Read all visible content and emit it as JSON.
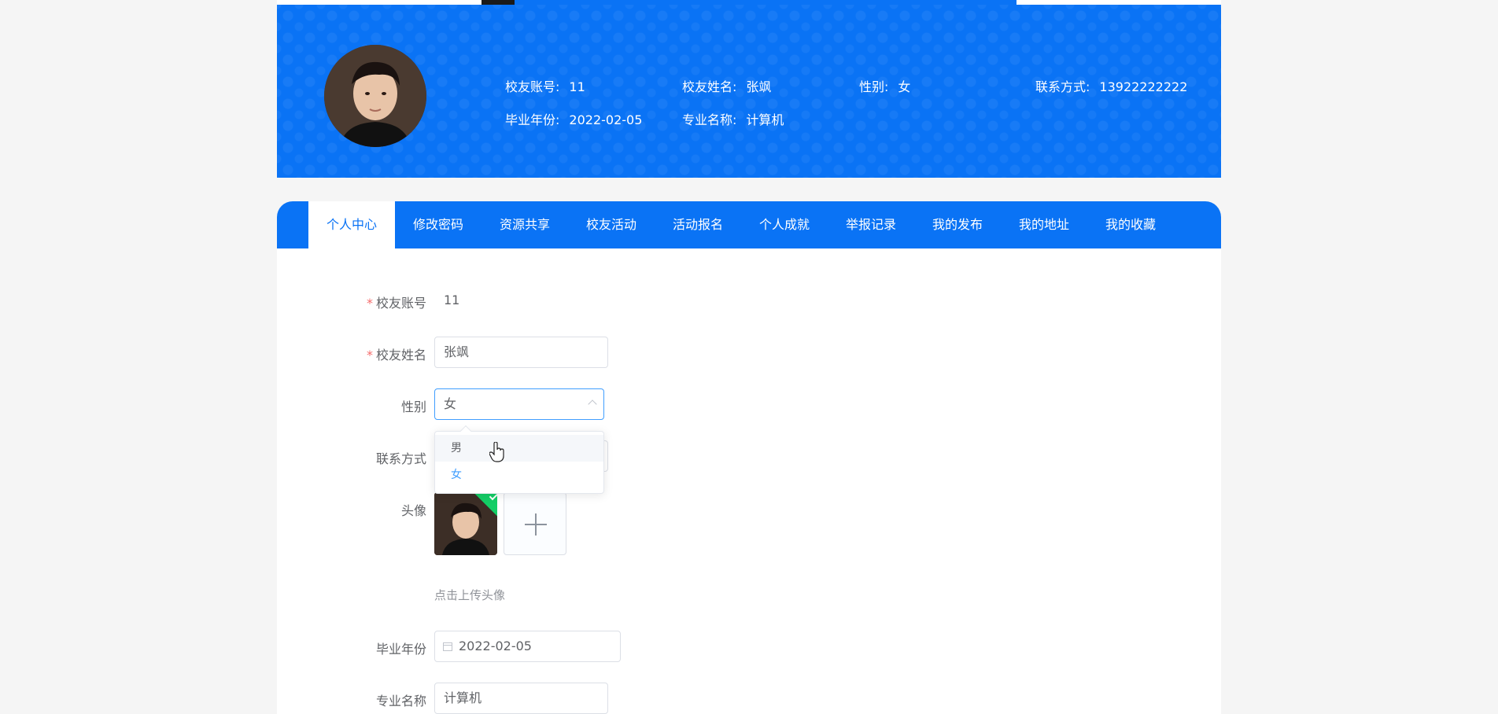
{
  "header": {
    "items": [
      {
        "label": "校友账号:",
        "value": "11"
      },
      {
        "label": "校友姓名:",
        "value": "张飒"
      },
      {
        "label": "性别:",
        "value": "女"
      },
      {
        "label": "联系方式:",
        "value": "13922222222"
      },
      {
        "label": "毕业年份:",
        "value": "2022-02-05"
      },
      {
        "label": "专业名称:",
        "value": "计算机"
      }
    ]
  },
  "nav": {
    "tabs": [
      "个人中心",
      "修改密码",
      "资源共享",
      "校友活动",
      "活动报名",
      "个人成就",
      "举报记录",
      "我的发布",
      "我的地址",
      "我的收藏"
    ],
    "active": "个人中心"
  },
  "form": {
    "account": {
      "label": "校友账号",
      "value": "11"
    },
    "name": {
      "label": "校友姓名",
      "value": "张飒"
    },
    "gender": {
      "label": "性别",
      "value": "女",
      "options": [
        "男",
        "女"
      ]
    },
    "phone": {
      "label": "联系方式"
    },
    "avatar": {
      "label": "头像",
      "hint": "点击上传头像"
    },
    "grad_year": {
      "label": "毕业年份",
      "value": "2022-02-05"
    },
    "major": {
      "label": "专业名称",
      "value": "计算机"
    }
  },
  "colors": {
    "primary": "#0a73f5",
    "required": "#f56c6c",
    "selected_option": "#409eff",
    "upload_ok": "#13ce66"
  }
}
